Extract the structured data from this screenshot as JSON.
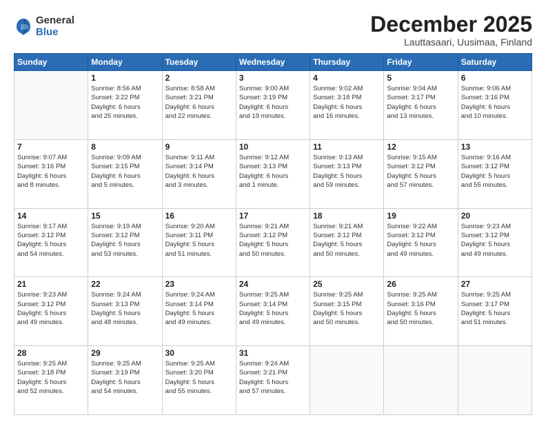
{
  "logo": {
    "general": "General",
    "blue": "Blue"
  },
  "title": "December 2025",
  "location": "Lauttasaari, Uusimaa, Finland",
  "days_header": [
    "Sunday",
    "Monday",
    "Tuesday",
    "Wednesday",
    "Thursday",
    "Friday",
    "Saturday"
  ],
  "weeks": [
    [
      {
        "num": "",
        "info": ""
      },
      {
        "num": "1",
        "info": "Sunrise: 8:56 AM\nSunset: 3:22 PM\nDaylight: 6 hours\nand 25 minutes."
      },
      {
        "num": "2",
        "info": "Sunrise: 8:58 AM\nSunset: 3:21 PM\nDaylight: 6 hours\nand 22 minutes."
      },
      {
        "num": "3",
        "info": "Sunrise: 9:00 AM\nSunset: 3:19 PM\nDaylight: 6 hours\nand 19 minutes."
      },
      {
        "num": "4",
        "info": "Sunrise: 9:02 AM\nSunset: 3:18 PM\nDaylight: 6 hours\nand 16 minutes."
      },
      {
        "num": "5",
        "info": "Sunrise: 9:04 AM\nSunset: 3:17 PM\nDaylight: 6 hours\nand 13 minutes."
      },
      {
        "num": "6",
        "info": "Sunrise: 9:06 AM\nSunset: 3:16 PM\nDaylight: 6 hours\nand 10 minutes."
      }
    ],
    [
      {
        "num": "7",
        "info": "Sunrise: 9:07 AM\nSunset: 3:16 PM\nDaylight: 6 hours\nand 8 minutes."
      },
      {
        "num": "8",
        "info": "Sunrise: 9:09 AM\nSunset: 3:15 PM\nDaylight: 6 hours\nand 5 minutes."
      },
      {
        "num": "9",
        "info": "Sunrise: 9:11 AM\nSunset: 3:14 PM\nDaylight: 6 hours\nand 3 minutes."
      },
      {
        "num": "10",
        "info": "Sunrise: 9:12 AM\nSunset: 3:13 PM\nDaylight: 6 hours\nand 1 minute."
      },
      {
        "num": "11",
        "info": "Sunrise: 9:13 AM\nSunset: 3:13 PM\nDaylight: 5 hours\nand 59 minutes."
      },
      {
        "num": "12",
        "info": "Sunrise: 9:15 AM\nSunset: 3:12 PM\nDaylight: 5 hours\nand 57 minutes."
      },
      {
        "num": "13",
        "info": "Sunrise: 9:16 AM\nSunset: 3:12 PM\nDaylight: 5 hours\nand 55 minutes."
      }
    ],
    [
      {
        "num": "14",
        "info": "Sunrise: 9:17 AM\nSunset: 3:12 PM\nDaylight: 5 hours\nand 54 minutes."
      },
      {
        "num": "15",
        "info": "Sunrise: 9:19 AM\nSunset: 3:12 PM\nDaylight: 5 hours\nand 53 minutes."
      },
      {
        "num": "16",
        "info": "Sunrise: 9:20 AM\nSunset: 3:11 PM\nDaylight: 5 hours\nand 51 minutes."
      },
      {
        "num": "17",
        "info": "Sunrise: 9:21 AM\nSunset: 3:12 PM\nDaylight: 5 hours\nand 50 minutes."
      },
      {
        "num": "18",
        "info": "Sunrise: 9:21 AM\nSunset: 3:12 PM\nDaylight: 5 hours\nand 50 minutes."
      },
      {
        "num": "19",
        "info": "Sunrise: 9:22 AM\nSunset: 3:12 PM\nDaylight: 5 hours\nand 49 minutes."
      },
      {
        "num": "20",
        "info": "Sunrise: 9:23 AM\nSunset: 3:12 PM\nDaylight: 5 hours\nand 49 minutes."
      }
    ],
    [
      {
        "num": "21",
        "info": "Sunrise: 9:23 AM\nSunset: 3:12 PM\nDaylight: 5 hours\nand 49 minutes."
      },
      {
        "num": "22",
        "info": "Sunrise: 9:24 AM\nSunset: 3:13 PM\nDaylight: 5 hours\nand 48 minutes."
      },
      {
        "num": "23",
        "info": "Sunrise: 9:24 AM\nSunset: 3:14 PM\nDaylight: 5 hours\nand 49 minutes."
      },
      {
        "num": "24",
        "info": "Sunrise: 9:25 AM\nSunset: 3:14 PM\nDaylight: 5 hours\nand 49 minutes."
      },
      {
        "num": "25",
        "info": "Sunrise: 9:25 AM\nSunset: 3:15 PM\nDaylight: 5 hours\nand 50 minutes."
      },
      {
        "num": "26",
        "info": "Sunrise: 9:25 AM\nSunset: 3:16 PM\nDaylight: 5 hours\nand 50 minutes."
      },
      {
        "num": "27",
        "info": "Sunrise: 9:25 AM\nSunset: 3:17 PM\nDaylight: 5 hours\nand 51 minutes."
      }
    ],
    [
      {
        "num": "28",
        "info": "Sunrise: 9:25 AM\nSunset: 3:18 PM\nDaylight: 5 hours\nand 52 minutes."
      },
      {
        "num": "29",
        "info": "Sunrise: 9:25 AM\nSunset: 3:19 PM\nDaylight: 5 hours\nand 54 minutes."
      },
      {
        "num": "30",
        "info": "Sunrise: 9:25 AM\nSunset: 3:20 PM\nDaylight: 5 hours\nand 55 minutes."
      },
      {
        "num": "31",
        "info": "Sunrise: 9:24 AM\nSunset: 3:21 PM\nDaylight: 5 hours\nand 57 minutes."
      },
      {
        "num": "",
        "info": ""
      },
      {
        "num": "",
        "info": ""
      },
      {
        "num": "",
        "info": ""
      }
    ]
  ]
}
